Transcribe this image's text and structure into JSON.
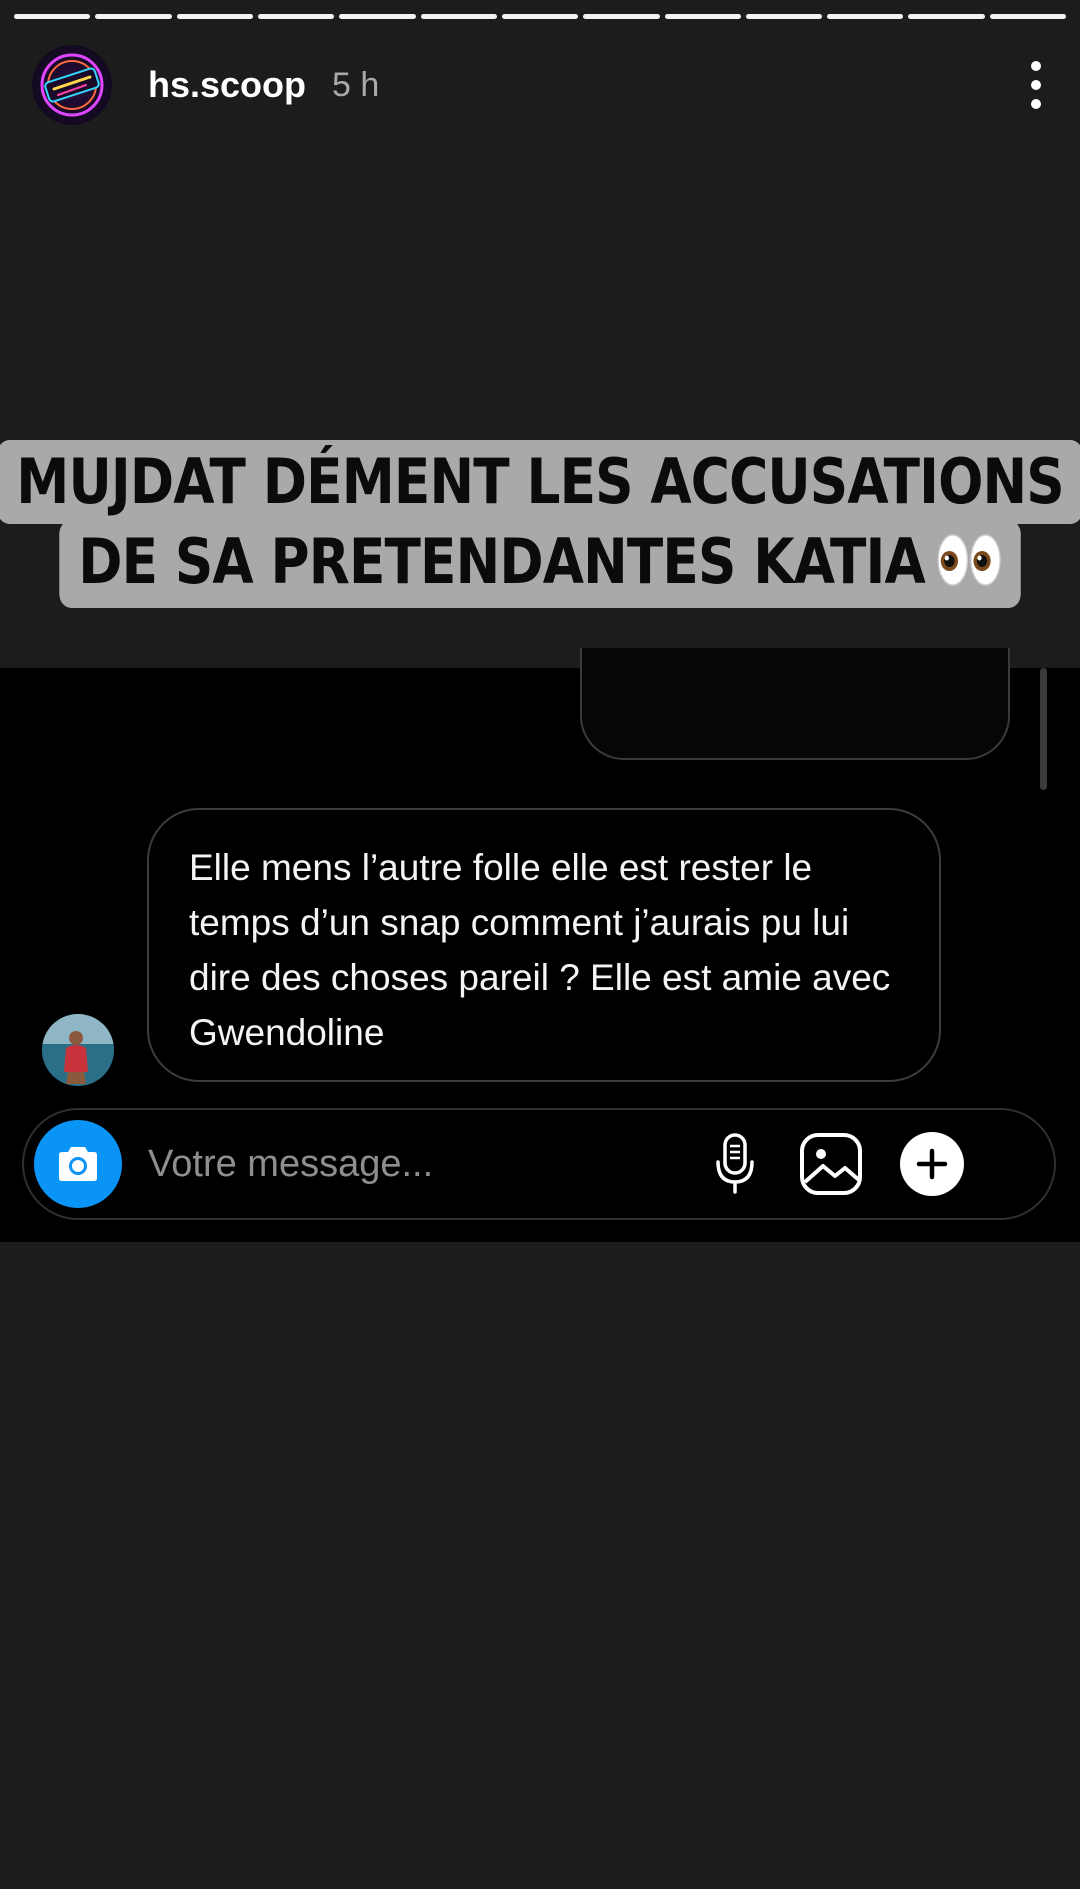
{
  "story": {
    "segments": 13,
    "username": "hs.scoop",
    "time": "5 h",
    "avatar_icon": "neon-logo",
    "more_icon": "more-vertical-icon"
  },
  "headline": {
    "line1": "MUJDAT DÉMENT LES ACCUSATIONS",
    "line2": "DE SA PRETENDANTES KATIA",
    "emoji_icon": "eyes-emoji-icon"
  },
  "screenshot": {
    "message_text": "Elle mens l’autre folle elle est rester le temps d’un snap comment j’aurais pu lui dire des choses pareil ? Elle est amie avec Gwendoline",
    "composer": {
      "placeholder": "Votre message...",
      "camera_icon": "camera-icon",
      "mic_icon": "microphone-icon",
      "gallery_icon": "image-icon",
      "plus_icon": "plus-icon",
      "accent": "#0a95f6"
    }
  }
}
